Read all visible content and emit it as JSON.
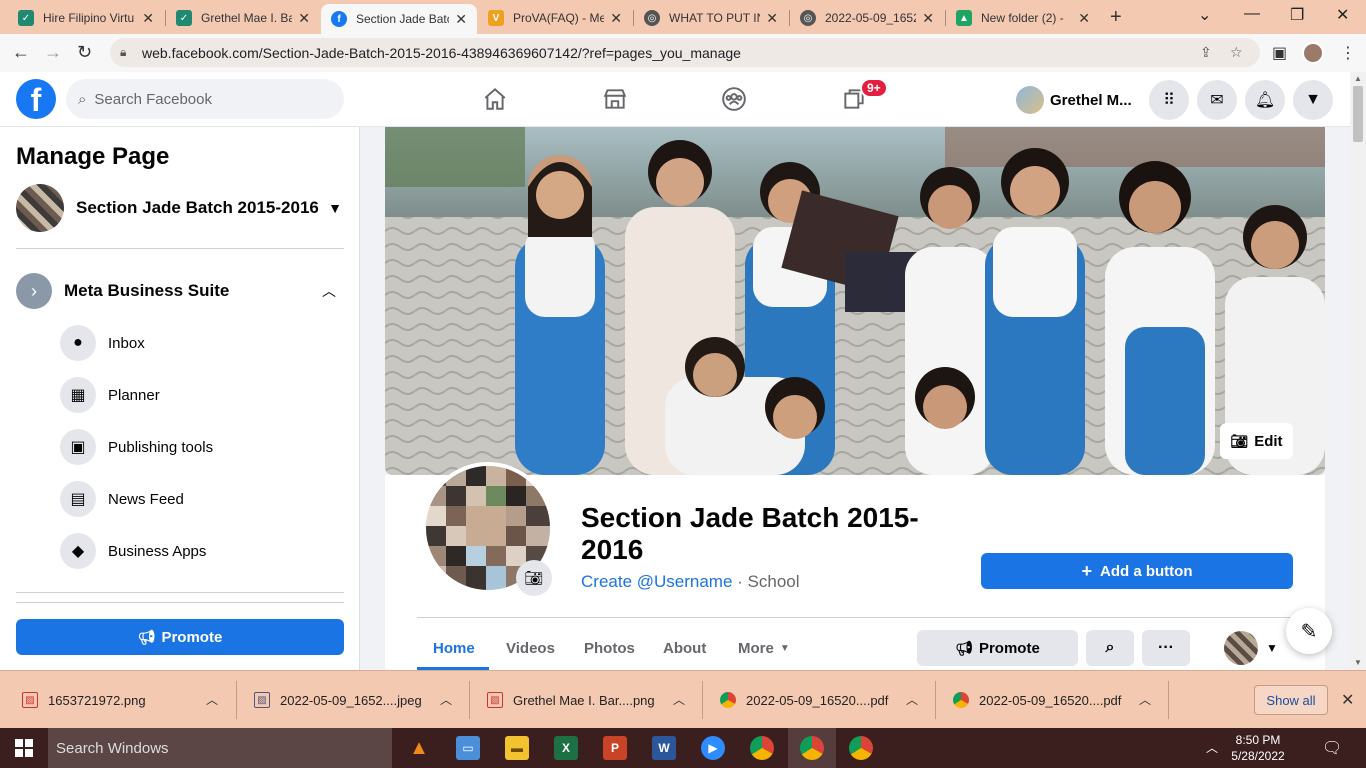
{
  "browser": {
    "tabs": [
      {
        "title": "Hire Filipino Virtu",
        "icon": "upwork-icon",
        "color": "#1f8a70"
      },
      {
        "title": "Grethel Mae I. Ba",
        "icon": "upwork-icon",
        "color": "#1f8a70"
      },
      {
        "title": "Section Jade Batc",
        "icon": "facebook-icon",
        "color": "#1877f2",
        "active": true
      },
      {
        "title": "ProVA(FAQ) - Me",
        "icon": "prova-icon",
        "color": "#f0a020"
      },
      {
        "title": "WHAT TO PUT IN",
        "icon": "globe-icon",
        "color": "#555555"
      },
      {
        "title": "2022-05-09_1652",
        "icon": "globe-icon",
        "color": "#555555"
      },
      {
        "title": "New folder (2) -",
        "icon": "drive-icon",
        "color": "#1fa463"
      }
    ],
    "url": "web.facebook.com/Section-Jade-Batch-2015-2016-438946369607142/?ref=pages_you_manage"
  },
  "fb": {
    "search_placeholder": "Search Facebook",
    "notif_badge": "9+",
    "user_name": "Grethel M..."
  },
  "sidebar": {
    "title": "Manage Page",
    "page_name": "Section Jade Batch 2015-2016",
    "suite_label": "Meta Business Suite",
    "items": [
      {
        "label": "Inbox",
        "icon": "chat-bubble-icon",
        "glyph": "●"
      },
      {
        "label": "Planner",
        "icon": "calendar-grid-icon",
        "glyph": "▦"
      },
      {
        "label": "Publishing tools",
        "icon": "publishing-tools-icon",
        "glyph": "▣"
      },
      {
        "label": "News Feed",
        "icon": "news-feed-icon",
        "glyph": "▤"
      },
      {
        "label": "Business Apps",
        "icon": "cube-icon",
        "glyph": "◆"
      }
    ],
    "promote_label": "Promote"
  },
  "page": {
    "name": "Section Jade Batch 2015-2016",
    "username_link": "Create @Username",
    "category": " · School",
    "edit_cover_label": "Edit",
    "add_button_label": "Add a button",
    "tabs": [
      "Home",
      "Videos",
      "Photos",
      "About",
      "More"
    ],
    "promote_label": "Promote"
  },
  "downloads": {
    "items": [
      {
        "name": "1653721972.png",
        "icon": "image-file-icon"
      },
      {
        "name": "2022-05-09_1652....jpeg",
        "icon": "image-file-icon"
      },
      {
        "name": "Grethel Mae I. Bar....png",
        "icon": "image-file-icon"
      },
      {
        "name": "2022-05-09_16520....pdf",
        "icon": "chrome-file-icon"
      },
      {
        "name": "2022-05-09_16520....pdf",
        "icon": "chrome-file-icon"
      }
    ],
    "show_all": "Show all"
  },
  "taskbar": {
    "search_placeholder": "Search Windows",
    "time": "8:50 PM",
    "date": "5/28/2022"
  }
}
